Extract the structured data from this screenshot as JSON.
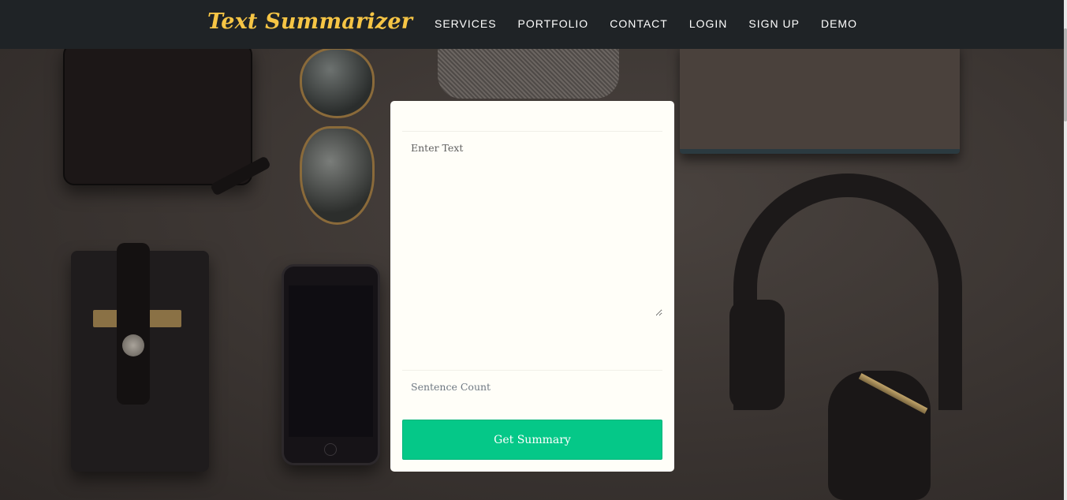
{
  "navbar": {
    "brand": "Text Summarizer",
    "links": [
      "SERVICES",
      "PORTFOLIO",
      "CONTACT",
      "LOGIN",
      "SIGN UP",
      "DEMO"
    ]
  },
  "form": {
    "text_placeholder": "Enter Text",
    "text_value": "",
    "count_placeholder": "Sentence Count",
    "count_value": "",
    "submit_label": "Get Summary"
  },
  "colors": {
    "navbar_bg": "#1f2326",
    "brand": "#f6c545",
    "button": "#05c888",
    "card_bg": "#fffef8"
  }
}
